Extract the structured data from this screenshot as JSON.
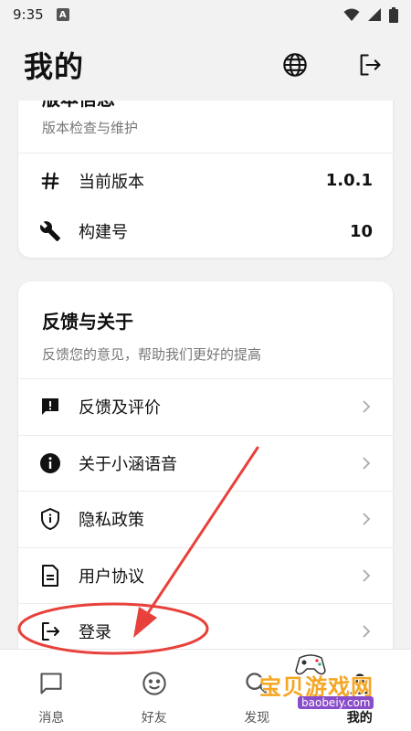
{
  "status_bar": {
    "time": "9:35",
    "notification_badge": "A"
  },
  "header": {
    "title": "我的"
  },
  "version_card": {
    "title": "版本信息",
    "subtitle": "版本检查与维护",
    "rows": [
      {
        "label": "当前版本",
        "value": "1.0.1",
        "icon": "hash-icon"
      },
      {
        "label": "构建号",
        "value": "10",
        "icon": "wrench-icon"
      }
    ]
  },
  "feedback_card": {
    "title": "反馈与关于",
    "subtitle": "反馈您的意见，帮助我们更好的提高",
    "rows": [
      {
        "label": "反馈及评价",
        "icon": "feedback-icon"
      },
      {
        "label": "关于小涵语音",
        "icon": "info-icon"
      },
      {
        "label": "隐私政策",
        "icon": "shield-icon"
      },
      {
        "label": "用户协议",
        "icon": "document-icon"
      },
      {
        "label": "登录",
        "icon": "login-icon"
      }
    ]
  },
  "bottom_nav": [
    {
      "label": "消息",
      "icon": "message-icon"
    },
    {
      "label": "好友",
      "icon": "smile-icon"
    },
    {
      "label": "发现",
      "icon": "search-icon"
    },
    {
      "label": "我的",
      "icon": "person-icon",
      "active": true
    }
  ],
  "watermark": {
    "text": "宝贝游戏网",
    "url": "baobeiy.com"
  },
  "colors": {
    "annotation": "#e8413b",
    "watermark": "#f5a623"
  }
}
